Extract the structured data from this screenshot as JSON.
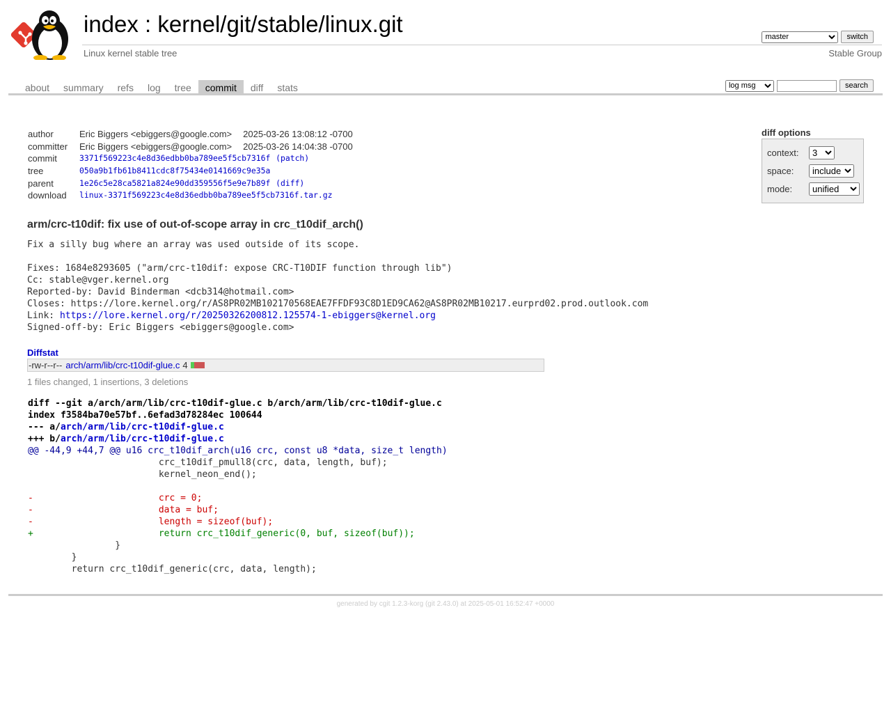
{
  "header": {
    "title_index": "index",
    "title_sep": " : ",
    "title_repo": "kernel/git/stable/linux.git",
    "description": "Linux kernel stable tree",
    "owner": "Stable Group",
    "branch_selected": "master",
    "switch_label": "switch",
    "logo_icon": "git-tux-logo"
  },
  "tabs": [
    "about",
    "summary",
    "refs",
    "log",
    "tree",
    "commit",
    "diff",
    "stats"
  ],
  "active_tab": "commit",
  "search": {
    "scope_selected": "log msg",
    "value": "",
    "button_label": "search"
  },
  "commit_info": {
    "author_label": "author",
    "author": "Eric Biggers <ebiggers@google.com>",
    "author_date": "2025-03-26 13:08:12 -0700",
    "committer_label": "committer",
    "committer": "Eric Biggers <ebiggers@google.com>",
    "committer_date": "2025-03-26 14:04:38 -0700",
    "commit_label": "commit",
    "commit_hash": "3371f569223c4e8d36edbb0ba789ee5f5cb7316f",
    "patch_link": "(patch)",
    "tree_label": "tree",
    "tree_hash": "050a9b1fb61b8411cdc8f75434e0141669c9e35a",
    "parent_label": "parent",
    "parent_hash": "1e26c5e28ca5821a824e90dd359556f5e9e7b89f",
    "diff_link": "(diff)",
    "download_label": "download",
    "download_file": "linux-3371f569223c4e8d36edbb0ba789ee5f5cb7316f.tar.gz"
  },
  "diff_options": {
    "title": "diff options",
    "context_label": "context:",
    "context_value": "3",
    "space_label": "space:",
    "space_value": "include",
    "mode_label": "mode:",
    "mode_value": "unified"
  },
  "subject": "arm/crc-t10dif: fix use of out-of-scope array in crc_t10dif_arch()",
  "message": {
    "body": "Fix a silly bug where an array was used outside of its scope.\n\nFixes: 1684e8293605 (\"arm/crc-t10dif: expose CRC-T10DIF function through lib\")\nCc: stable@vger.kernel.org\nReported-by: David Binderman <dcb314@hotmail.com>\nCloses: https://lore.kernel.org/r/AS8PR02MB102170568EAE7FFDF93C8D1ED9CA62@AS8PR02MB10217.eurprd02.prod.outlook.com\n",
    "link_prefix": "Link: ",
    "link_url": "https://lore.kernel.org/r/20250326200812.125574-1-ebiggers@kernel.org",
    "signoff": "\nSigned-off-by: Eric Biggers <ebiggers@google.com>"
  },
  "diffstat": {
    "header": "Diffstat",
    "mode": "-rw-r--r--",
    "file": "arch/arm/lib/crc-t10dif-glue.c",
    "count": "4",
    "insertions": 1,
    "deletions": 3,
    "summary": "1 files changed, 1 insertions, 3 deletions"
  },
  "diff": {
    "line1": "diff --git a/arch/arm/lib/crc-t10dif-glue.c b/arch/arm/lib/crc-t10dif-glue.c",
    "line2": "index f3584ba70e57bf..6efad3d78284ec 100644",
    "minus_prefix": "--- a/",
    "plus_prefix": "+++ b/",
    "file_path": "arch/arm/lib/crc-t10dif-glue.c",
    "hunk": "@@ -44,9 +44,7 @@ u16 crc_t10dif_arch(u16 crc, const u8 *data, size_t length)",
    "ctx1": "\t\t\tcrc_t10dif_pmull8(crc, data, length, buf);",
    "ctx2": "\t\t\tkernel_neon_end();",
    "ctx3": "",
    "del1": "-\t\t\tcrc = 0;",
    "del2": "-\t\t\tdata = buf;",
    "del3": "-\t\t\tlength = sizeof(buf);",
    "add1": "+\t\t\treturn crc_t10dif_generic(0, buf, sizeof(buf));",
    "ctx4": "\t\t}",
    "ctx5": "\t}",
    "ctx6": "\treturn crc_t10dif_generic(crc, data, length);"
  },
  "footer": {
    "prefix": "generated by ",
    "cgit": "cgit 1.2.3-korg",
    "git": "(git 2.43.0)",
    "suffix": " at 2025-05-01 16:52:47 +0000"
  },
  "colors": {
    "link": "#0000cc",
    "add": "#008000",
    "del": "#cc0000",
    "hunk": "#000099",
    "tab_active_bg": "#cccccc"
  }
}
